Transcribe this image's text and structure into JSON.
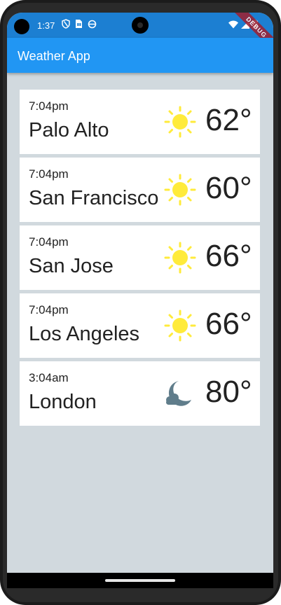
{
  "status_bar": {
    "time": "1:37",
    "left_icons": [
      "shield-icon",
      "sim-card-icon",
      "data-saver-icon"
    ],
    "right_icons": [
      "wifi-icon",
      "signal-icon",
      "battery-icon"
    ]
  },
  "debug_banner": "DEBUG",
  "app_bar": {
    "title": "Weather App",
    "color": "#2196f3"
  },
  "locations": [
    {
      "time": "7:04pm",
      "city": "Palo Alto",
      "temp": "62°",
      "icon": "sun-icon"
    },
    {
      "time": "7:04pm",
      "city": "San Francisco",
      "temp": "60°",
      "icon": "sun-icon"
    },
    {
      "time": "7:04pm",
      "city": "San Jose",
      "temp": "66°",
      "icon": "sun-icon"
    },
    {
      "time": "7:04pm",
      "city": "Los Angeles",
      "temp": "66°",
      "icon": "sun-icon"
    },
    {
      "time": "3:04am",
      "city": "London",
      "temp": "80°",
      "icon": "moon-cloud-icon"
    }
  ],
  "colors": {
    "sun": "#ffeb3b",
    "moon": "#607d8b",
    "background": "#d1d9de"
  }
}
